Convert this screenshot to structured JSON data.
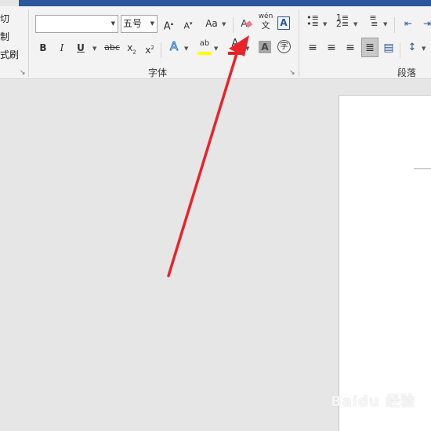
{
  "clipboard": {
    "cut": "切",
    "copy": "制",
    "painter": "式刷"
  },
  "font": {
    "name_value": "",
    "size_value": "五号",
    "grow": "A",
    "shrink": "A",
    "change_case": "Aa",
    "clear_format": "A",
    "phonetic_top": "wén",
    "phonetic_bottom": "文",
    "char_border": "A",
    "bold": "B",
    "italic": "I",
    "underline": "U",
    "strikethrough": "abc",
    "subscript": "x",
    "subscript_mark": "2",
    "superscript": "x",
    "superscript_mark": "2",
    "text_effects": "A",
    "highlight": "ab",
    "font_color": "A",
    "char_shading": "A",
    "enclose": "字",
    "group_label": "字体"
  },
  "paragraph": {
    "group_label": "段落"
  },
  "colors": {
    "accent": "#2b579a",
    "highlight": "#ffff00",
    "font_color": "#e02020",
    "arrow": "#e8232a"
  },
  "watermark": "Baidu 经验"
}
